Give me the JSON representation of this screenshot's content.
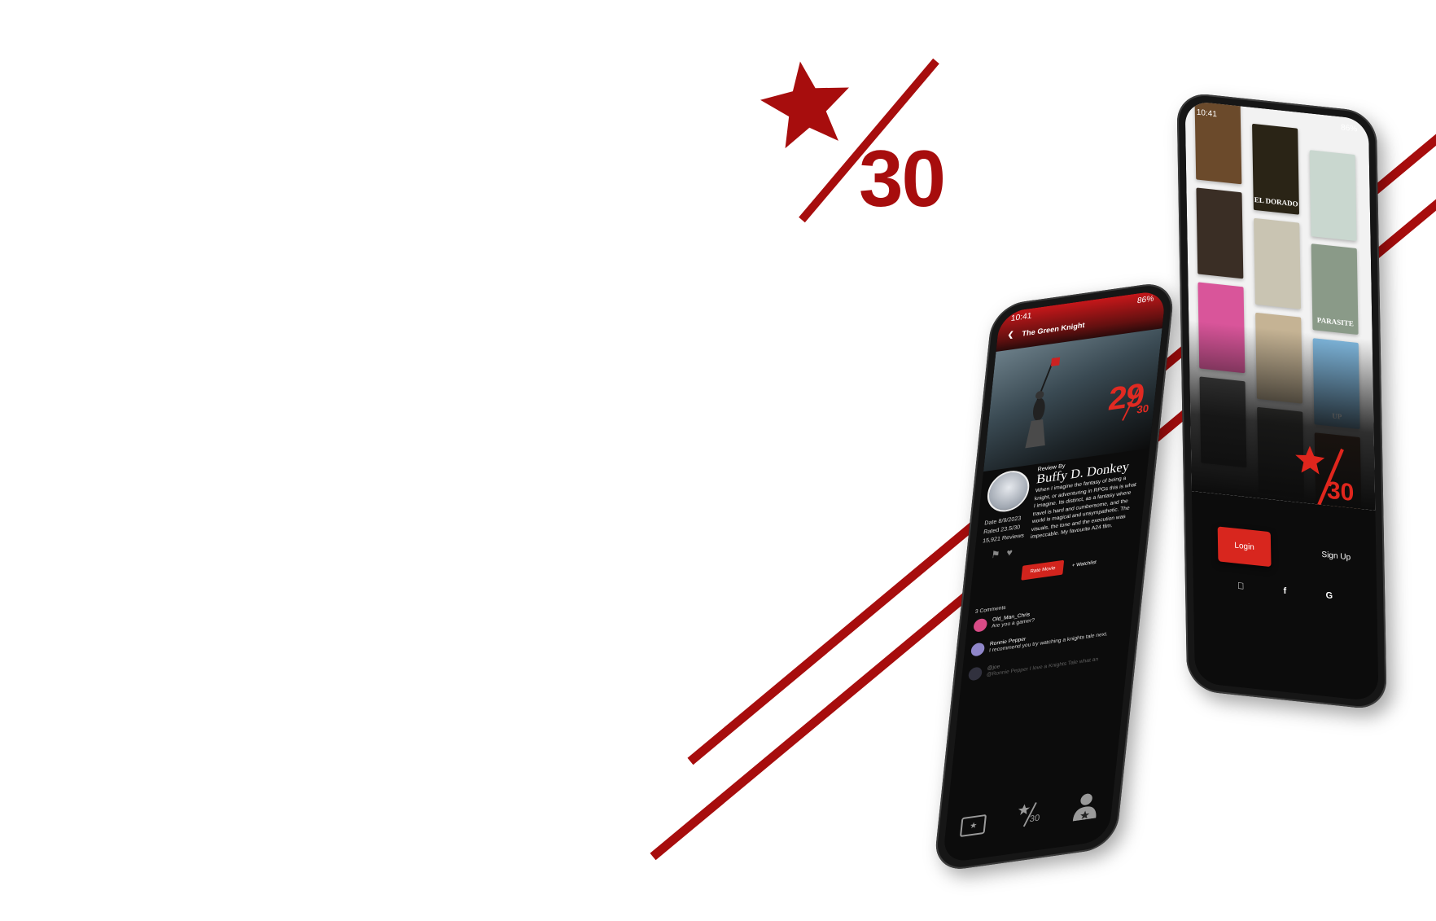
{
  "brand": {
    "logo_denominator": "30",
    "accent": "#a70d0d",
    "accent_bright": "#e0261d"
  },
  "review_screen": {
    "status_time": "10:41",
    "status_battery": "86%",
    "header_title": "The Green Knight",
    "score": "29",
    "score_denominator": "30",
    "review_by_label": "Review By",
    "reviewer_name": "Buffy D. Donkey",
    "review_text": "When I imagine the fantasy of being a knight, or adventuring in RPGs this is what I imagine. Its distinct, as a fantasy where travel is hard and cumbersome, and the world is magical and unsympathetic. The visuals, the tone and the execution was impeccable. My favourite A24 film.",
    "date_line": "Date 8/9/2023",
    "rated_line": "Rated 23.5/30",
    "reviews_line": "15,921 Reviews",
    "rate_button": "Rate Movie",
    "watchlist_label": "Watchlist",
    "comments_count": "3 Comments",
    "comments": [
      {
        "user": "Old_Man_Chris",
        "text": "Are you a gamer?"
      },
      {
        "user": "Ronnie Pepper",
        "text": "I recommend you try watching a knights tale next."
      },
      {
        "user": "@joe",
        "text": "@Ronnie Pepper I love a Knights Tale what an"
      }
    ],
    "nav_logo": "30"
  },
  "login_screen": {
    "status_time": "10:41",
    "status_battery": "86%",
    "posters": [
      {
        "label": "",
        "color": "#6b4a2b"
      },
      {
        "label": "EL DORADO",
        "color": "#2a2416"
      },
      {
        "label": "",
        "color": "#c9d7cf"
      },
      {
        "label": "",
        "color": "#3a2e25"
      },
      {
        "label": "",
        "color": "#c9c4b2"
      },
      {
        "label": "PARASITE",
        "color": "#8a9a88"
      },
      {
        "label": "",
        "color": "#d9559a"
      },
      {
        "label": "",
        "color": "#c5b394"
      },
      {
        "label": "UP",
        "color": "#7fb7dd"
      },
      {
        "label": "",
        "color": "#4f4f4f"
      },
      {
        "label": "",
        "color": "#5a5a55"
      },
      {
        "label": "",
        "color": "#6a3d22"
      }
    ],
    "logo_denominator": "30",
    "login_button": "Login",
    "signup_label": "Sign Up",
    "social": [
      {
        "icon": "apple-icon",
        "glyph": ""
      },
      {
        "icon": "facebook-icon",
        "glyph": "f"
      },
      {
        "icon": "google-icon",
        "glyph": "G"
      }
    ]
  }
}
